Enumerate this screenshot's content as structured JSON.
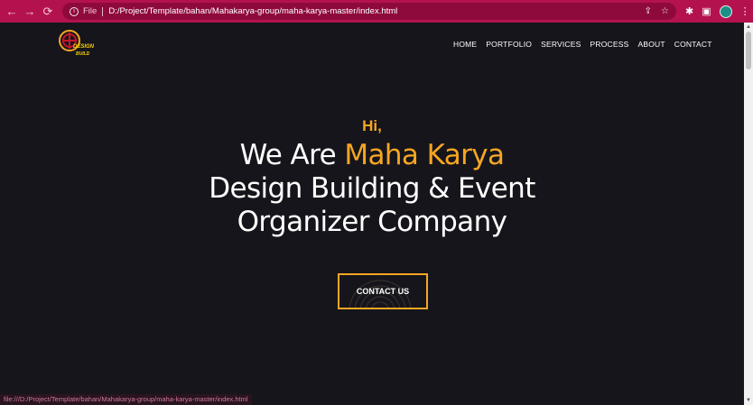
{
  "browser": {
    "back_icon": "←",
    "forward_icon": "→",
    "reload_icon": "⟳",
    "info_icon": "i",
    "scheme_label": "File",
    "url": "D:/Project/Template/bahan/Mahakarya-group/maha-karya-master/index.html",
    "share_icon": "⇪",
    "star_icon": "☆",
    "extensions_icon": "✱",
    "sidepanel_icon": "▣",
    "menu_icon": "⋮"
  },
  "nav": {
    "items": [
      {
        "label": "HOME"
      },
      {
        "label": "PORTFOLIO"
      },
      {
        "label": "SERVICES"
      },
      {
        "label": "PROCESS"
      },
      {
        "label": "ABOUT"
      },
      {
        "label": "CONTACT"
      }
    ]
  },
  "logo": {
    "text_top": "DESIGN",
    "text_bottom": "BUILD"
  },
  "hero": {
    "greeting": "Hi,",
    "line1_prefix": "We Are ",
    "line1_accent": "Maha Karya",
    "line2": "Design Building & Event",
    "line3": "Organizer Company",
    "cta_label": "CONTACT US"
  },
  "status": {
    "link": "file:///D:/Project/Template/bahan/Mahakarya-group/maha-karya-master/index.html"
  },
  "colors": {
    "accent": "#f6a623",
    "background": "#16151b",
    "browser_bar": "#b4124f"
  }
}
